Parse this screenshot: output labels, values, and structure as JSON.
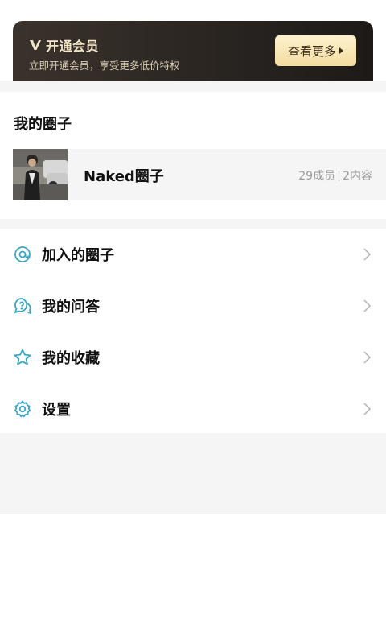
{
  "vip": {
    "title": "开通会员",
    "subtitle": "立即开通会员，享受更多低价特权",
    "button_label": "查看更多"
  },
  "my_circle": {
    "section_title": "我的圈子",
    "items": [
      {
        "name": "Naked圈子",
        "members": "29成员",
        "contents": "2内容"
      }
    ]
  },
  "menu": [
    {
      "label": "加入的圈子",
      "icon": "joined-circle-icon"
    },
    {
      "label": "我的问答",
      "icon": "question-chat-icon"
    },
    {
      "label": "我的收藏",
      "icon": "star-icon"
    },
    {
      "label": "设置",
      "icon": "gear-icon"
    }
  ],
  "colors": {
    "accent_icon": "#3aa8c2",
    "vip_gold": "#f3e6c9",
    "background_gray": "#f5f5f5"
  }
}
